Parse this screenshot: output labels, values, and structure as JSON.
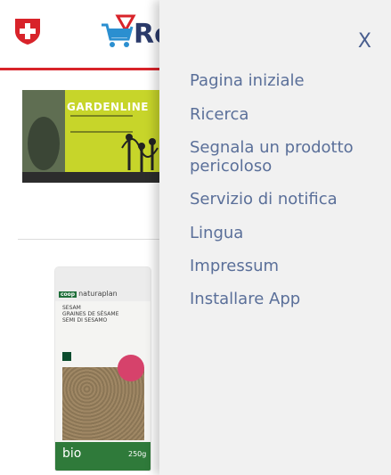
{
  "header": {
    "brand_partial": "Re",
    "shield_icon": "swiss-cross-shield",
    "cart_icon": "shopping-cart-with-warning-triangle",
    "accent_color": "#d8232a"
  },
  "products": [
    {
      "brand": "GARDENLINE",
      "icon": "garden-lights-package"
    },
    {
      "brand": "naturaplan",
      "lines": [
        "SESAM",
        "GRAINES DE SÉSAME",
        "SEMI DI SESAMO"
      ],
      "bio": "bio",
      "weight": "250g"
    }
  ],
  "drawer": {
    "close_label": "X",
    "menu_items": [
      "Pagina iniziale",
      "Ricerca",
      "Segnala un prodotto pericoloso",
      "Servizio di notifica",
      "Lingua",
      "Impressum",
      "Installare App"
    ],
    "text_color": "#5a6f99",
    "background": "#f1f1f1"
  }
}
